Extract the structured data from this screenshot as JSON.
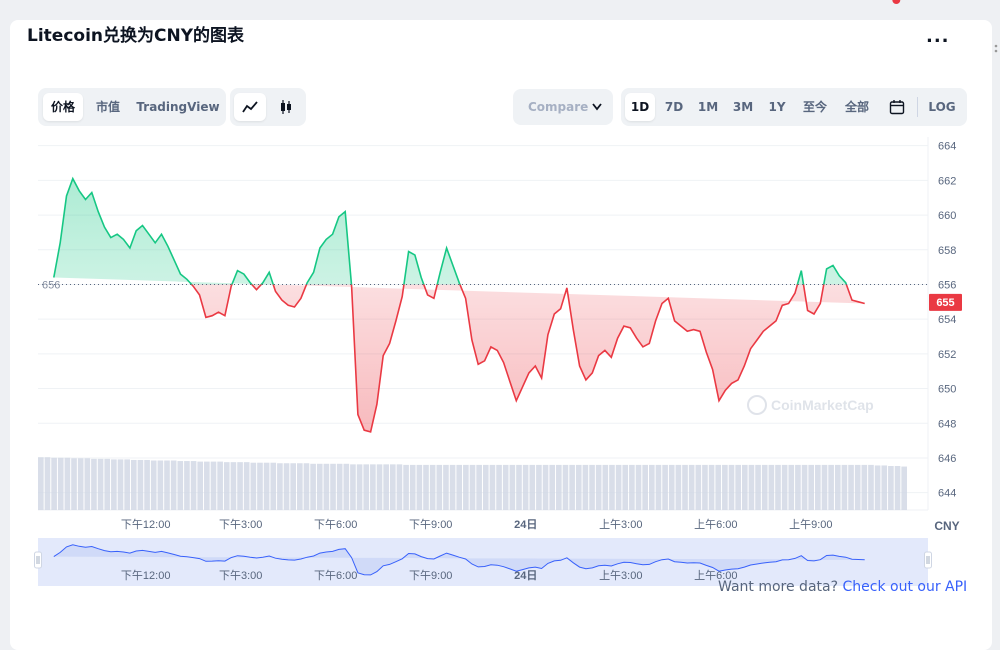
{
  "title": "Litecoin兑换为CNY的图表",
  "more_label": "...",
  "view_tabs": [
    {
      "label": "价格",
      "active": true
    },
    {
      "label": "市值",
      "active": false
    },
    {
      "label": "TradingView",
      "active": false
    }
  ],
  "chart_style_icons": [
    {
      "name": "line-chart-icon",
      "active": true
    },
    {
      "name": "candlestick-icon",
      "active": false
    }
  ],
  "compare": {
    "label": "Compare"
  },
  "range_tabs": [
    {
      "label": "1D",
      "active": true
    },
    {
      "label": "7D",
      "active": false
    },
    {
      "label": "1M",
      "active": false
    },
    {
      "label": "3M",
      "active": false
    },
    {
      "label": "1Y",
      "active": false
    },
    {
      "label": "至今",
      "active": false
    },
    {
      "label": "全部",
      "active": false
    }
  ],
  "log_label": "LOG",
  "currency_label": "CNY",
  "watermark": "CoinMarketCap",
  "footer": {
    "text": "Want more data?",
    "link": "Check out our API"
  },
  "colors": {
    "up": "#16c784",
    "down": "#ea3943",
    "accent": "#3861fb",
    "text": "#58667e"
  },
  "chart_data": {
    "type": "line",
    "baseline": 656,
    "last_value": 655,
    "ylim": [
      643,
      664.5
    ],
    "yticks": [
      664,
      662,
      660,
      658,
      656,
      654,
      652,
      650,
      648,
      646,
      644
    ],
    "xtick_labels": [
      "下午12:00",
      "下午3:00",
      "下午6:00",
      "下午9:00",
      "24日",
      "上午3:00",
      "上午6:00",
      "上午9:00"
    ],
    "navigator_tick_labels": [
      "下午12:00",
      "下午3:00",
      "下午6:00",
      "下午9:00",
      "24日",
      "上午3:00",
      "上午6:00"
    ],
    "hours": [
      9.1,
      9.3,
      9.5,
      9.7,
      9.9,
      10.1,
      10.3,
      10.5,
      10.7,
      10.9,
      11.1,
      11.3,
      11.5,
      11.7,
      11.9,
      12.1,
      12.3,
      12.5,
      12.7,
      12.9,
      13.1,
      13.3,
      13.5,
      13.7,
      13.9,
      14.1,
      14.3,
      14.5,
      14.7,
      14.9,
      15.1,
      15.3,
      15.5,
      15.7,
      15.9,
      16.1,
      16.3,
      16.5,
      16.7,
      16.9,
      17.1,
      17.3,
      17.5,
      17.7,
      17.9,
      18.1,
      18.3,
      18.5,
      18.7,
      18.9,
      19.1,
      19.3,
      19.5,
      19.7,
      19.9,
      20.1,
      20.3,
      20.5,
      20.7,
      20.9,
      21.1,
      21.3,
      21.5,
      21.7,
      21.9,
      22.1,
      22.3,
      22.5,
      22.7,
      22.9,
      23.1,
      23.3,
      23.5,
      23.7,
      23.9,
      24.1,
      24.3,
      24.5,
      24.7,
      24.9,
      25.1,
      25.3,
      25.5,
      25.7,
      25.9,
      26.1,
      26.3,
      26.5,
      26.7,
      26.9,
      27.1,
      27.3,
      27.5,
      27.7,
      27.9,
      28.1,
      28.3,
      28.5,
      28.7,
      28.9,
      29.1,
      29.3,
      29.5,
      29.7,
      29.9,
      30.1,
      30.3,
      30.5,
      30.7,
      30.9,
      31.1,
      31.3,
      31.5,
      31.7,
      31.9,
      32.1,
      32.3,
      32.5,
      32.7,
      32.9,
      33.1,
      33.3,
      33.5,
      33.7,
      33.9,
      34.1,
      34.3,
      34.5,
      34.7,
      34.9,
      35.1,
      35.3,
      35.5,
      35.7
    ],
    "prices": [
      656.4,
      658.4,
      661.1,
      662.1,
      661.4,
      660.9,
      661.3,
      660.2,
      659.3,
      658.7,
      658.9,
      658.6,
      658.1,
      659.1,
      659.4,
      658.9,
      658.4,
      658.9,
      658.2,
      657.4,
      656.6,
      656.3,
      655.9,
      655.4,
      654.1,
      654.2,
      654.4,
      654.2,
      655.9,
      656.8,
      656.6,
      656.1,
      655.7,
      656.1,
      656.7,
      655.6,
      655.1,
      654.8,
      654.7,
      655.2,
      656.1,
      656.7,
      658.1,
      658.6,
      658.9,
      659.9,
      660.2,
      655.9,
      648.5,
      647.6,
      647.5,
      649.1,
      651.9,
      652.6,
      653.9,
      655.3,
      657.9,
      657.7,
      656.4,
      655.4,
      655.2,
      656.7,
      658.1,
      657.1,
      656.1,
      655.2,
      652.8,
      651.4,
      651.6,
      652.4,
      652.2,
      651.5,
      650.4,
      649.3,
      650.1,
      650.9,
      651.3,
      650.6,
      653.1,
      654.3,
      654.6,
      655.8,
      653.4,
      651.3,
      650.5,
      650.9,
      651.9,
      652.2,
      651.8,
      652.9,
      653.6,
      653.5,
      652.9,
      652.4,
      652.6,
      653.9,
      654.9,
      655.2,
      653.9,
      653.6,
      653.3,
      653.4,
      653.3,
      652.1,
      651.1,
      649.3,
      649.9,
      650.3,
      650.5,
      651.3,
      652.3,
      652.8,
      653.3,
      653.6,
      653.9,
      654.8,
      654.9,
      655.5,
      656.8,
      654.5,
      654.3,
      654.9,
      656.9,
      657.1,
      656.5,
      656.1,
      655.1,
      655.0,
      654.9
    ],
    "volume_ylim": [
      0,
      100
    ],
    "volume_values": [
      96,
      96,
      95,
      95,
      95,
      94,
      94,
      94,
      93,
      93,
      93,
      92,
      92,
      92,
      91,
      91,
      91,
      90,
      90,
      90,
      90,
      89,
      89,
      89,
      88,
      88,
      88,
      88,
      87,
      87,
      87,
      87,
      86,
      86,
      86,
      86,
      85,
      85,
      85,
      85,
      85,
      84,
      84,
      84,
      84,
      84,
      84,
      83,
      83,
      83,
      83,
      83,
      83,
      83,
      83,
      82,
      82,
      82,
      82,
      82,
      82,
      82,
      82,
      82,
      82,
      82,
      82,
      82,
      82,
      82,
      82,
      82,
      82,
      82,
      82,
      82,
      82,
      82,
      82,
      82,
      82,
      82,
      82,
      82,
      82,
      82,
      82,
      82,
      82,
      82,
      82,
      82,
      82,
      82,
      82,
      82,
      82,
      82,
      82,
      82,
      82,
      82,
      82,
      82,
      82,
      82,
      82,
      82,
      82,
      82,
      82,
      82,
      82,
      82,
      82,
      82,
      82,
      82,
      82,
      82,
      82,
      82,
      82,
      82,
      82,
      82,
      81,
      81,
      80,
      80,
      79
    ],
    "x_tick_hours": [
      12,
      15,
      18,
      21,
      24,
      27,
      30,
      33
    ],
    "grid": true
  }
}
